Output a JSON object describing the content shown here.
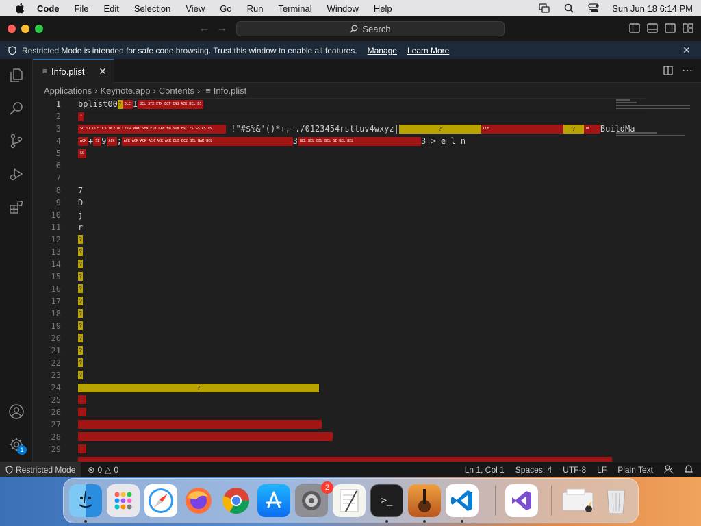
{
  "menubar": {
    "apple_icon": "apple-logo",
    "app_name": "Code",
    "items": [
      "File",
      "Edit",
      "Selection",
      "View",
      "Go",
      "Run",
      "Terminal",
      "Window",
      "Help"
    ],
    "right_icons": [
      "screen-mirroring-icon",
      "spotlight-icon",
      "control-center-icon"
    ],
    "clock": "Sun Jun 18  6:14 PM"
  },
  "titlebar": {
    "search_label": "Search"
  },
  "banner": {
    "message": "Restricted Mode is intended for safe code browsing. Trust this window to enable all features.",
    "manage": "Manage",
    "learn_more": "Learn More"
  },
  "tab": {
    "label": "Info.plist"
  },
  "breadcrumb": {
    "items": [
      "Applications",
      "Keynote.app",
      "Contents",
      "Info.plist"
    ]
  },
  "editor": {
    "line_numbers": [
      "1",
      "2",
      "3",
      "4",
      "5",
      "6",
      "7",
      "8",
      "9",
      "10",
      "11",
      "12",
      "13",
      "14",
      "15",
      "16",
      "17",
      "18",
      "19",
      "20",
      "21",
      "22",
      "23",
      "24",
      "25",
      "26",
      "27",
      "28",
      "29"
    ],
    "active_line": "1",
    "lines": {
      "l1": "bplist00",
      "l1b": "1",
      "l3": "!\"#$%&'()*+,-./0123454rsttuv4wxyz|",
      "l3b": "BuildMa",
      "l4a": "+",
      "l4b": "9",
      "l4c": ";",
      "l4d": "3",
      "l4e": "3    >    e    l    n",
      "l8": "7",
      "l9": "D",
      "l10": "j",
      "l11": "r"
    }
  },
  "statusbar": {
    "restricted": "Restricted Mode",
    "errors": "0",
    "warnings": "0",
    "position": "Ln 1, Col 1",
    "spaces": "Spaces: 4",
    "encoding": "UTF-8",
    "eol": "LF",
    "language": "Plain Text"
  },
  "activity": {
    "manage_badge": "1"
  },
  "dock": {
    "settings_badge": "2",
    "apps": [
      "finder",
      "launchpad",
      "safari",
      "firefox",
      "chrome",
      "app-store",
      "system-settings",
      "textedit",
      "terminal",
      "garageband",
      "vscode",
      "visual-studio",
      "preview",
      "trash"
    ]
  }
}
